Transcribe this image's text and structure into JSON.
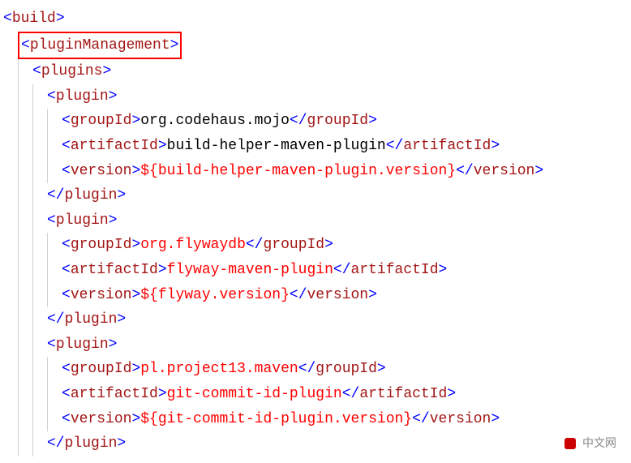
{
  "watermark": "中文网",
  "lines": [
    {
      "indent": 0,
      "highlight": false,
      "segments": [
        {
          "cls": "t-bracket",
          "t": "<"
        },
        {
          "cls": "t-tag",
          "t": "build"
        },
        {
          "cls": "t-bracket",
          "t": ">"
        }
      ]
    },
    {
      "indent": 1,
      "highlight": true,
      "segments": [
        {
          "cls": "t-bracket",
          "t": "<"
        },
        {
          "cls": "t-tag",
          "t": "pluginManagement"
        },
        {
          "cls": "t-bracket",
          "t": ">"
        }
      ]
    },
    {
      "indent": 2,
      "highlight": false,
      "segments": [
        {
          "cls": "t-bracket",
          "t": "<"
        },
        {
          "cls": "t-tag",
          "t": "plugins"
        },
        {
          "cls": "t-bracket",
          "t": ">"
        }
      ]
    },
    {
      "indent": 3,
      "highlight": false,
      "segments": [
        {
          "cls": "t-bracket",
          "t": "<"
        },
        {
          "cls": "t-tag",
          "t": "plugin"
        },
        {
          "cls": "t-bracket",
          "t": ">"
        }
      ]
    },
    {
      "indent": 4,
      "highlight": false,
      "segments": [
        {
          "cls": "t-bracket",
          "t": "<"
        },
        {
          "cls": "t-tag",
          "t": "groupId"
        },
        {
          "cls": "t-bracket",
          "t": ">"
        },
        {
          "cls": "t-text",
          "t": "org.codehaus.mojo"
        },
        {
          "cls": "t-bracket",
          "t": "</"
        },
        {
          "cls": "t-tag",
          "t": "groupId"
        },
        {
          "cls": "t-bracket",
          "t": ">"
        }
      ]
    },
    {
      "indent": 4,
      "highlight": false,
      "segments": [
        {
          "cls": "t-bracket",
          "t": "<"
        },
        {
          "cls": "t-tag",
          "t": "artifactId"
        },
        {
          "cls": "t-bracket",
          "t": ">"
        },
        {
          "cls": "t-text",
          "t": "build-helper-maven-plugin"
        },
        {
          "cls": "t-bracket",
          "t": "</"
        },
        {
          "cls": "t-tag",
          "t": "artifactId"
        },
        {
          "cls": "t-bracket",
          "t": ">"
        }
      ]
    },
    {
      "indent": 4,
      "highlight": false,
      "segments": [
        {
          "cls": "t-bracket",
          "t": "<"
        },
        {
          "cls": "t-tag",
          "t": "version"
        },
        {
          "cls": "t-bracket",
          "t": ">"
        },
        {
          "cls": "t-expr",
          "t": "${build-helper-maven-plugin.version}"
        },
        {
          "cls": "t-bracket",
          "t": "</"
        },
        {
          "cls": "t-tag",
          "t": "version"
        },
        {
          "cls": "t-bracket",
          "t": ">"
        }
      ]
    },
    {
      "indent": 3,
      "highlight": false,
      "segments": [
        {
          "cls": "t-bracket",
          "t": "</"
        },
        {
          "cls": "t-tag",
          "t": "plugin"
        },
        {
          "cls": "t-bracket",
          "t": ">"
        }
      ]
    },
    {
      "indent": 3,
      "highlight": false,
      "segments": [
        {
          "cls": "t-bracket",
          "t": "<"
        },
        {
          "cls": "t-tag",
          "t": "plugin"
        },
        {
          "cls": "t-bracket",
          "t": ">"
        }
      ]
    },
    {
      "indent": 4,
      "highlight": false,
      "segments": [
        {
          "cls": "t-bracket",
          "t": "<"
        },
        {
          "cls": "t-tag",
          "t": "groupId"
        },
        {
          "cls": "t-bracket",
          "t": ">"
        },
        {
          "cls": "t-expr",
          "t": "org.flywaydb"
        },
        {
          "cls": "t-bracket",
          "t": "</"
        },
        {
          "cls": "t-tag",
          "t": "groupId"
        },
        {
          "cls": "t-bracket",
          "t": ">"
        }
      ]
    },
    {
      "indent": 4,
      "highlight": false,
      "segments": [
        {
          "cls": "t-bracket",
          "t": "<"
        },
        {
          "cls": "t-tag",
          "t": "artifactId"
        },
        {
          "cls": "t-bracket",
          "t": ">"
        },
        {
          "cls": "t-expr",
          "t": "flyway-maven-plugin"
        },
        {
          "cls": "t-bracket",
          "t": "</"
        },
        {
          "cls": "t-tag",
          "t": "artifactId"
        },
        {
          "cls": "t-bracket",
          "t": ">"
        }
      ]
    },
    {
      "indent": 4,
      "highlight": false,
      "segments": [
        {
          "cls": "t-bracket",
          "t": "<"
        },
        {
          "cls": "t-tag",
          "t": "version"
        },
        {
          "cls": "t-bracket",
          "t": ">"
        },
        {
          "cls": "t-expr",
          "t": "${flyway.version}"
        },
        {
          "cls": "t-bracket",
          "t": "</"
        },
        {
          "cls": "t-tag",
          "t": "version"
        },
        {
          "cls": "t-bracket",
          "t": ">"
        }
      ]
    },
    {
      "indent": 3,
      "highlight": false,
      "segments": [
        {
          "cls": "t-bracket",
          "t": "</"
        },
        {
          "cls": "t-tag",
          "t": "plugin"
        },
        {
          "cls": "t-bracket",
          "t": ">"
        }
      ]
    },
    {
      "indent": 3,
      "highlight": false,
      "segments": [
        {
          "cls": "t-bracket",
          "t": "<"
        },
        {
          "cls": "t-tag",
          "t": "plugin"
        },
        {
          "cls": "t-bracket",
          "t": ">"
        }
      ]
    },
    {
      "indent": 4,
      "highlight": false,
      "segments": [
        {
          "cls": "t-bracket",
          "t": "<"
        },
        {
          "cls": "t-tag",
          "t": "groupId"
        },
        {
          "cls": "t-bracket",
          "t": ">"
        },
        {
          "cls": "t-expr",
          "t": "pl.project13.maven"
        },
        {
          "cls": "t-bracket",
          "t": "</"
        },
        {
          "cls": "t-tag",
          "t": "groupId"
        },
        {
          "cls": "t-bracket",
          "t": ">"
        }
      ]
    },
    {
      "indent": 4,
      "highlight": false,
      "segments": [
        {
          "cls": "t-bracket",
          "t": "<"
        },
        {
          "cls": "t-tag",
          "t": "artifactId"
        },
        {
          "cls": "t-bracket",
          "t": ">"
        },
        {
          "cls": "t-expr",
          "t": "git-commit-id-plugin"
        },
        {
          "cls": "t-bracket",
          "t": "</"
        },
        {
          "cls": "t-tag",
          "t": "artifactId"
        },
        {
          "cls": "t-bracket",
          "t": ">"
        }
      ]
    },
    {
      "indent": 4,
      "highlight": false,
      "segments": [
        {
          "cls": "t-bracket",
          "t": "<"
        },
        {
          "cls": "t-tag",
          "t": "version"
        },
        {
          "cls": "t-bracket",
          "t": ">"
        },
        {
          "cls": "t-expr",
          "t": "${git-commit-id-plugin.version}"
        },
        {
          "cls": "t-bracket",
          "t": "</"
        },
        {
          "cls": "t-tag",
          "t": "version"
        },
        {
          "cls": "t-bracket",
          "t": ">"
        }
      ]
    },
    {
      "indent": 3,
      "highlight": false,
      "segments": [
        {
          "cls": "t-bracket",
          "t": "</"
        },
        {
          "cls": "t-tag",
          "t": "plugin"
        },
        {
          "cls": "t-bracket",
          "t": ">"
        }
      ]
    }
  ]
}
